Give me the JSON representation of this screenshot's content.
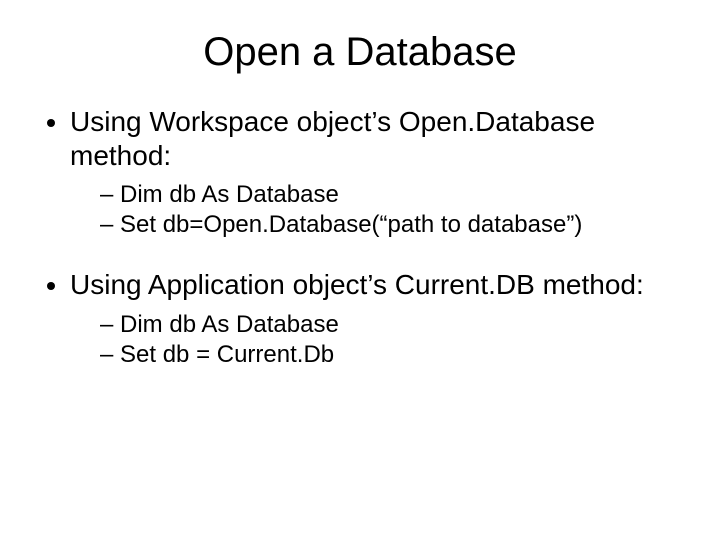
{
  "title": "Open a Database",
  "bullets": [
    {
      "text": "Using Workspace object’s Open.Database method:",
      "sub": [
        "Dim db As Database",
        "Set  db=Open.Database(“path to database”)"
      ]
    },
    {
      "text": "Using Application object’s Current.DB method:",
      "sub": [
        "Dim db As Database",
        "Set db = Current.Db"
      ]
    }
  ]
}
